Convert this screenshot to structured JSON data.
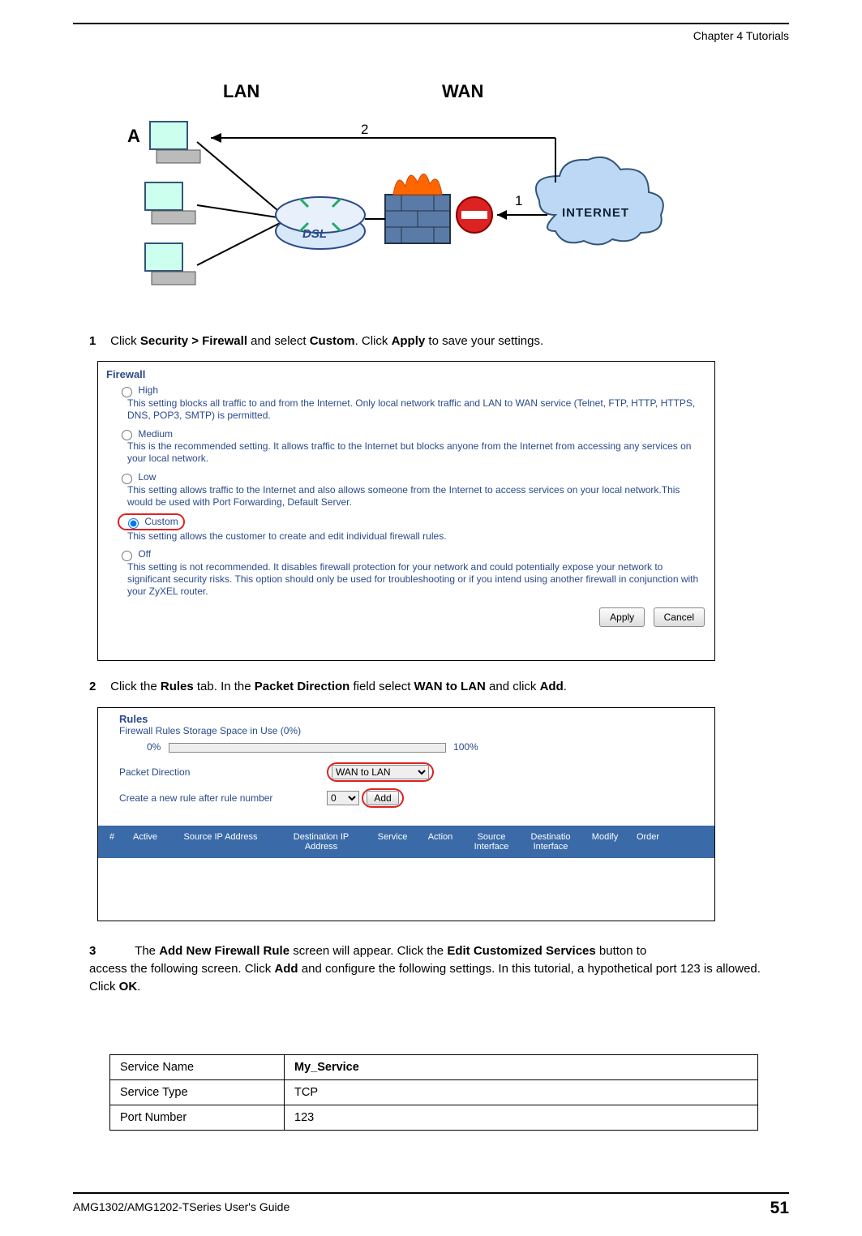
{
  "header": {
    "chapter": "Chapter 4 Tutorials"
  },
  "diagram": {
    "lan_label": "LAN",
    "wan_label": "WAN",
    "a_label": "A",
    "arrow2": "2",
    "arrow1": "1",
    "dsl_label": "DSL",
    "internet_label": "INTERNET"
  },
  "steps": {
    "s1_num": "1",
    "s1_text": "Click Security > Firewall and select Custom. Click Apply to save your settings.",
    "s2_num": "2",
    "s2_text": "Click the Rules tab. In the Packet Direction field select WAN to LAN and click Add.",
    "s3_num": "3",
    "s3_text": "The Add New Firewall Rule screen will appear. Click the Edit Customized Services button to access the following screen. Click Add and configure the following settings. In this tutorial, a hypothetical port 123 is allowed. Click OK."
  },
  "firewall": {
    "title": "Firewall",
    "high": "High",
    "high_desc": "This setting blocks all traffic to and from the Internet. Only local network traffic and LAN to WAN service (Telnet, FTP, HTTP, HTTPS, DNS, POP3, SMTP) is permitted.",
    "medium": "Medium",
    "medium_desc": "This is the recommended setting. It allows traffic to the Internet but blocks anyone from the Internet from accessing any services on your local network.",
    "low": "Low",
    "low_desc": "This setting allows traffic to the Internet and also allows someone from the Internet to access services on your local network.This would be used with Port Forwarding, Default Server.",
    "custom": "Custom",
    "custom_desc": "This setting allows the customer to create and edit individual firewall rules.",
    "off": "Off",
    "off_desc": "This setting is not recommended. It disables firewall protection for your network and could potentially expose your network to significant security risks. This option should only be used for troubleshooting or if you intend using another firewall in conjunction with your ZyXEL router.",
    "apply": "Apply",
    "cancel": "Cancel"
  },
  "rules": {
    "title": "Rules",
    "storage_label": "Firewall Rules Storage Space in Use (0%)",
    "zero": "0%",
    "hundred": "100%",
    "packet_dir_label": "Packet Direction",
    "packet_dir_value": "WAN to LAN",
    "create_label": "Create a new rule after rule number",
    "create_value": "0",
    "add": "Add",
    "cols": {
      "num": "#",
      "active": "Active",
      "src": "Source IP Address",
      "dst": "Destination IP Address",
      "svc": "Service",
      "action": "Action",
      "si": "Source Interface",
      "di": "Destinatio Interface",
      "modify": "Modify",
      "order": "Order"
    }
  },
  "service_table": {
    "name_label": "Service Name",
    "name_value": "My_Service",
    "type_label": "Service Type",
    "type_value": "TCP",
    "port_label": "Port Number",
    "port_value": "123"
  },
  "footer": {
    "guide": "AMG1302/AMG1202-TSeries User's Guide",
    "page": "51"
  }
}
